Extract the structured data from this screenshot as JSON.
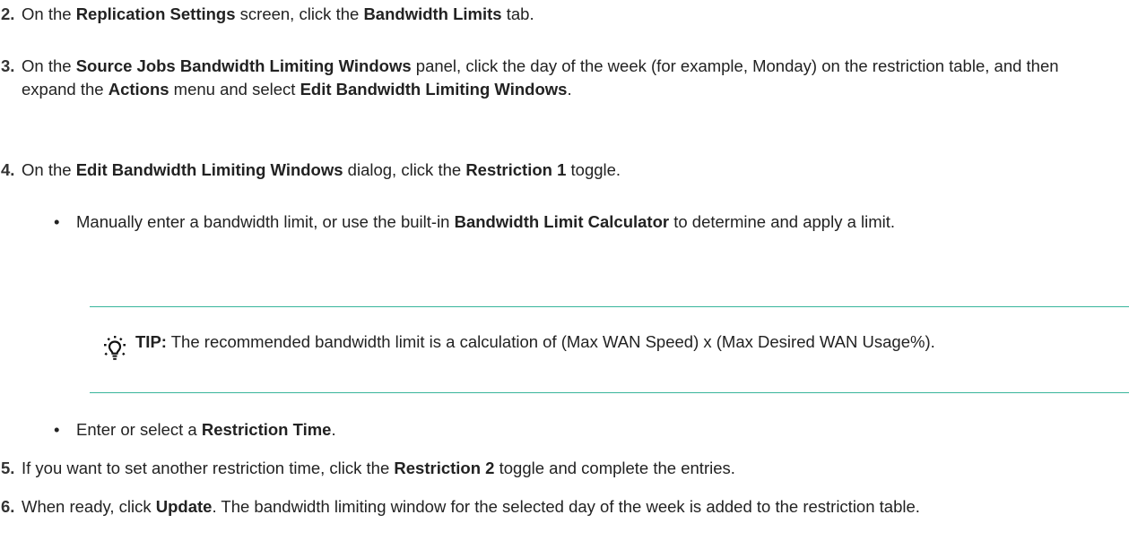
{
  "steps": [
    {
      "num": "2.",
      "parts": [
        {
          "t": "On the "
        },
        {
          "t": "Replication Settings",
          "b": true
        },
        {
          "t": " screen, click the "
        },
        {
          "t": "Bandwidth Limits",
          "b": true
        },
        {
          "t": " tab."
        }
      ]
    },
    {
      "num": "3.",
      "parts": [
        {
          "t": "On the "
        },
        {
          "t": "Source Jobs Bandwidth Limiting Windows",
          "b": true
        },
        {
          "t": " panel, click the day of the week (for example, Monday) on the restriction table, and then expand the "
        },
        {
          "t": "Actions",
          "b": true
        },
        {
          "t": " menu and select "
        },
        {
          "t": "Edit Bandwidth Limiting Windows",
          "b": true
        },
        {
          "t": "."
        }
      ]
    },
    {
      "num": "4.",
      "parts": [
        {
          "t": "On the "
        },
        {
          "t": "Edit Bandwidth Limiting Windows",
          "b": true
        },
        {
          "t": " dialog, click the "
        },
        {
          "t": "Restriction 1",
          "b": true
        },
        {
          "t": " toggle."
        }
      ]
    },
    {
      "num": "5.",
      "parts": [
        {
          "t": "If you want to set another restriction time, click the "
        },
        {
          "t": "Restriction 2",
          "b": true
        },
        {
          "t": " toggle and complete the entries."
        }
      ]
    },
    {
      "num": "6.",
      "parts": [
        {
          "t": "When ready, click "
        },
        {
          "t": "Update",
          "b": true
        },
        {
          "t": ". The bandwidth limiting window for the selected day of the week is added to the restriction table."
        }
      ]
    }
  ],
  "bullets": [
    {
      "parts": [
        {
          "t": "Manually enter a bandwidth limit, or use the built-in "
        },
        {
          "t": "Bandwidth Limit Calculator",
          "b": true
        },
        {
          "t": " to determine and apply a limit."
        }
      ]
    },
    {
      "parts": [
        {
          "t": "Enter or select a "
        },
        {
          "t": "Restriction Time",
          "b": true
        },
        {
          "t": "."
        }
      ]
    }
  ],
  "tip": {
    "label": "TIP:",
    "text": " The recommended bandwidth limit is a calculation of (Max WAN Speed) x (Max Desired WAN Usage%).",
    "icon": "lightbulb-icon",
    "rule_color": "#38b59b"
  },
  "bullet_char": "•"
}
